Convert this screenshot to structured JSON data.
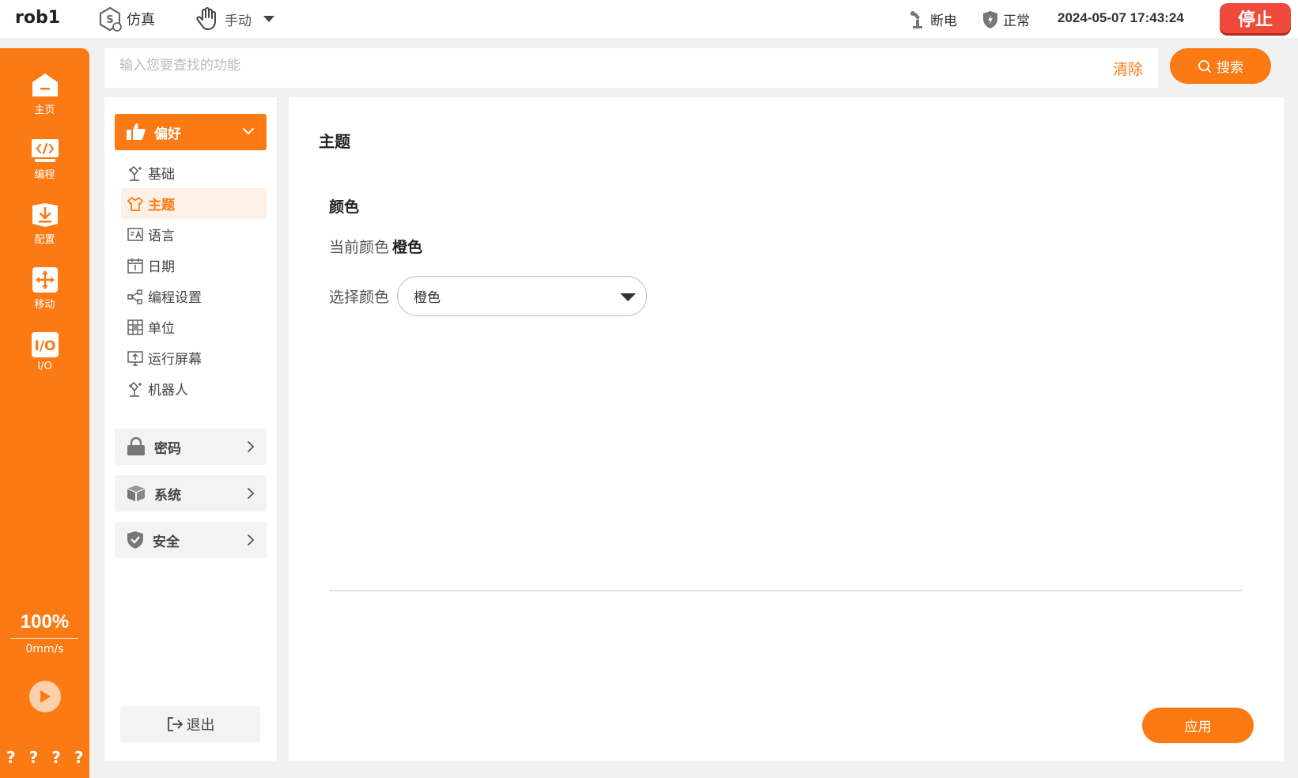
{
  "header": {
    "robot_name": "rob1",
    "mode_sim": "仿真",
    "mode_manual": "手动",
    "power_status": "断电",
    "safety_status": "正常",
    "datetime": "2024-05-07 17:43:24",
    "stop_label": "停止"
  },
  "sidebar": {
    "items": [
      {
        "label": "主页",
        "icon": "home-icon"
      },
      {
        "label": "编程",
        "icon": "code-icon"
      },
      {
        "label": "配置",
        "icon": "download-config-icon"
      },
      {
        "label": "移动",
        "icon": "move-arrows-icon"
      },
      {
        "label": "I/O",
        "icon": "io-icon"
      }
    ],
    "speed_percent": "100%",
    "speed_value": "0mm/s",
    "bottom_marks": [
      "?",
      "?",
      "?",
      "?"
    ]
  },
  "search": {
    "placeholder": "输入您要查找的功能",
    "clear_label": "清除",
    "button_label": "搜索"
  },
  "settings_nav": {
    "active_category": "偏好",
    "sub_items": [
      {
        "label": "基础",
        "icon": "robot-arm-icon"
      },
      {
        "label": "主题",
        "icon": "shirt-icon"
      },
      {
        "label": "语言",
        "icon": "translate-icon"
      },
      {
        "label": "日期",
        "icon": "calendar-icon"
      },
      {
        "label": "编程设置",
        "icon": "share-nodes-icon"
      },
      {
        "label": "单位",
        "icon": "grid-icon"
      },
      {
        "label": "运行屏幕",
        "icon": "screen-upload-icon"
      },
      {
        "label": "机器人",
        "icon": "robot-arm-icon"
      }
    ],
    "categories": [
      {
        "label": "密码",
        "icon": "lock-icon"
      },
      {
        "label": "系统",
        "icon": "box-icon"
      },
      {
        "label": "安全",
        "icon": "shield-check-icon"
      }
    ],
    "logout_label": "退出"
  },
  "main": {
    "page_title": "主题",
    "section_title": "颜色",
    "current_color_label": "当前颜色",
    "current_color_value": "橙色",
    "select_label": "选择颜色",
    "select_value": "橙色",
    "apply_label": "应用"
  },
  "colors": {
    "accent": "#fb7a14",
    "stop": "#f04a3a",
    "active_bg": "#fff0e5"
  }
}
